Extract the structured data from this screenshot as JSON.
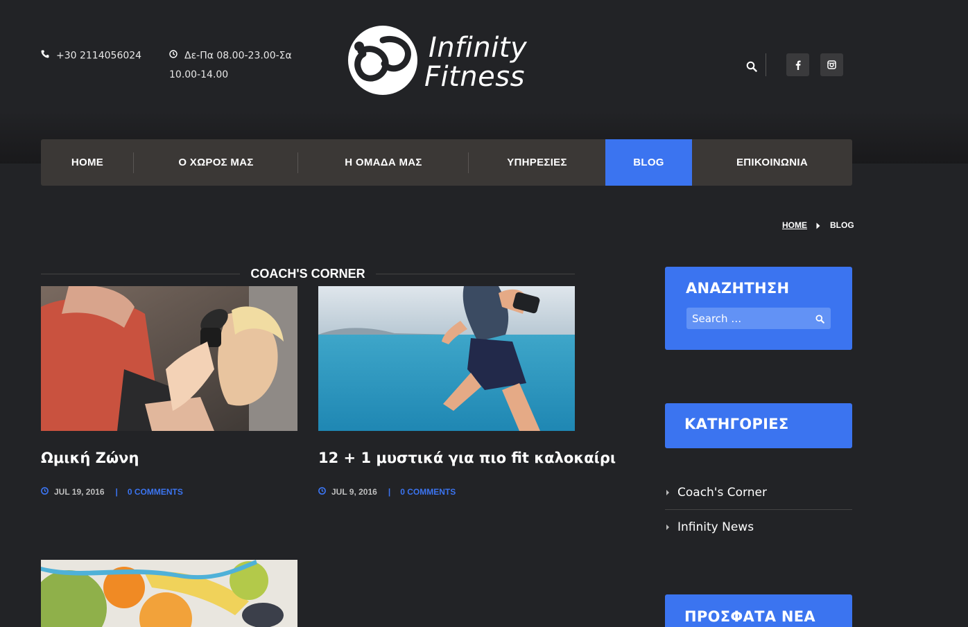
{
  "header": {
    "phone": "+30 2114056024",
    "hours": "Δε-Πα 08.00-23.00-Σα 10.00-14.00",
    "logo": {
      "line1": "Infinity",
      "line2": "Fitness"
    }
  },
  "nav": {
    "items": [
      {
        "label": "HOME"
      },
      {
        "label": "Ο ΧΩΡΟΣ ΜΑΣ"
      },
      {
        "label": "Η ΟΜΑΔΑ ΜΑΣ"
      },
      {
        "label": "ΥΠΗΡΕΣΙΕΣ"
      },
      {
        "label": "BLOG",
        "active": true
      },
      {
        "label": "ΕΠΙΚΟΙΝΩΝΙΑ"
      }
    ]
  },
  "breadcrumb": {
    "home": "HOME",
    "current": "BLOG"
  },
  "section": {
    "title": "COACH'S CORNER"
  },
  "posts": [
    {
      "title": "Ωμική Ζώνη",
      "date": "JUL 19, 2016",
      "comments": "0 COMMENTS"
    },
    {
      "title": "12 + 1 μυστικά για πιο fit καλοκαίρι",
      "date": "JUL 9, 2016",
      "comments": "0 COMMENTS"
    }
  ],
  "sidebar": {
    "search": {
      "title": "ΑΝΑΖΗΤΗΣΗ",
      "placeholder": "Search …"
    },
    "categories": {
      "title": "ΚΑΤΗΓΟΡΙΕΣ",
      "items": [
        "Coach's Corner",
        "Infinity News"
      ]
    },
    "recent": {
      "title": "ΠΡΟΣΦΑΤΑ ΝΕΑ"
    }
  },
  "colors": {
    "accent": "#3b74f0",
    "background": "#222326",
    "nav": "#3b3836"
  },
  "icons": [
    "phone-icon",
    "clock-icon",
    "search-icon",
    "facebook-icon",
    "instagram-icon",
    "caret-right-icon"
  ]
}
